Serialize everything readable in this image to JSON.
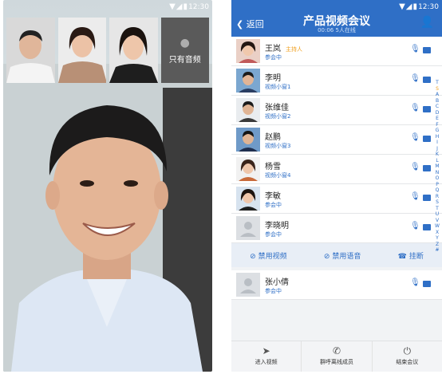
{
  "left": {
    "status_time": "12:30",
    "status_icons": "▼◢▮",
    "audio_only_label": "只有音频"
  },
  "right": {
    "status_time": "12:30",
    "status_icons": "▼◢▮",
    "back_label": "返回",
    "title": "产品视频会议",
    "subtitle": "00:06  5人在线",
    "participants": [
      {
        "name": "王岚",
        "sub": "参会中",
        "host": "主持人"
      },
      {
        "name": "李明",
        "sub": "视频小窗1"
      },
      {
        "name": "张维佳",
        "sub": "视频小窗2"
      },
      {
        "name": "赵鹏",
        "sub": "视频小窗3"
      },
      {
        "name": "杨雪",
        "sub": "视频小窗4"
      },
      {
        "name": "李敏",
        "sub": "参会中"
      },
      {
        "name": "李晓明",
        "sub": "参会中"
      },
      {
        "name": "张小倩",
        "sub": "参会中"
      }
    ],
    "actions": {
      "disable_video": "禁用视频",
      "disable_audio": "禁用语音",
      "hangup": "挂断"
    },
    "bottom": {
      "enter_video": "进入视频",
      "call_offline": "群呼离线成员",
      "end_meeting": "结束会议"
    },
    "alphabet": [
      "T",
      "S",
      "A",
      "B",
      "C",
      "D",
      "E",
      "F",
      "G",
      "H",
      "I",
      "J",
      "K",
      "L",
      "M",
      "N",
      "O",
      "P",
      "Q",
      "R",
      "S",
      "T",
      "U",
      "V",
      "W",
      "X",
      "Y",
      "Z",
      "#"
    ]
  },
  "colors": {
    "accent": "#2f6fc6",
    "host": "#f0a020",
    "audio_tile": "#5a5a5a"
  }
}
